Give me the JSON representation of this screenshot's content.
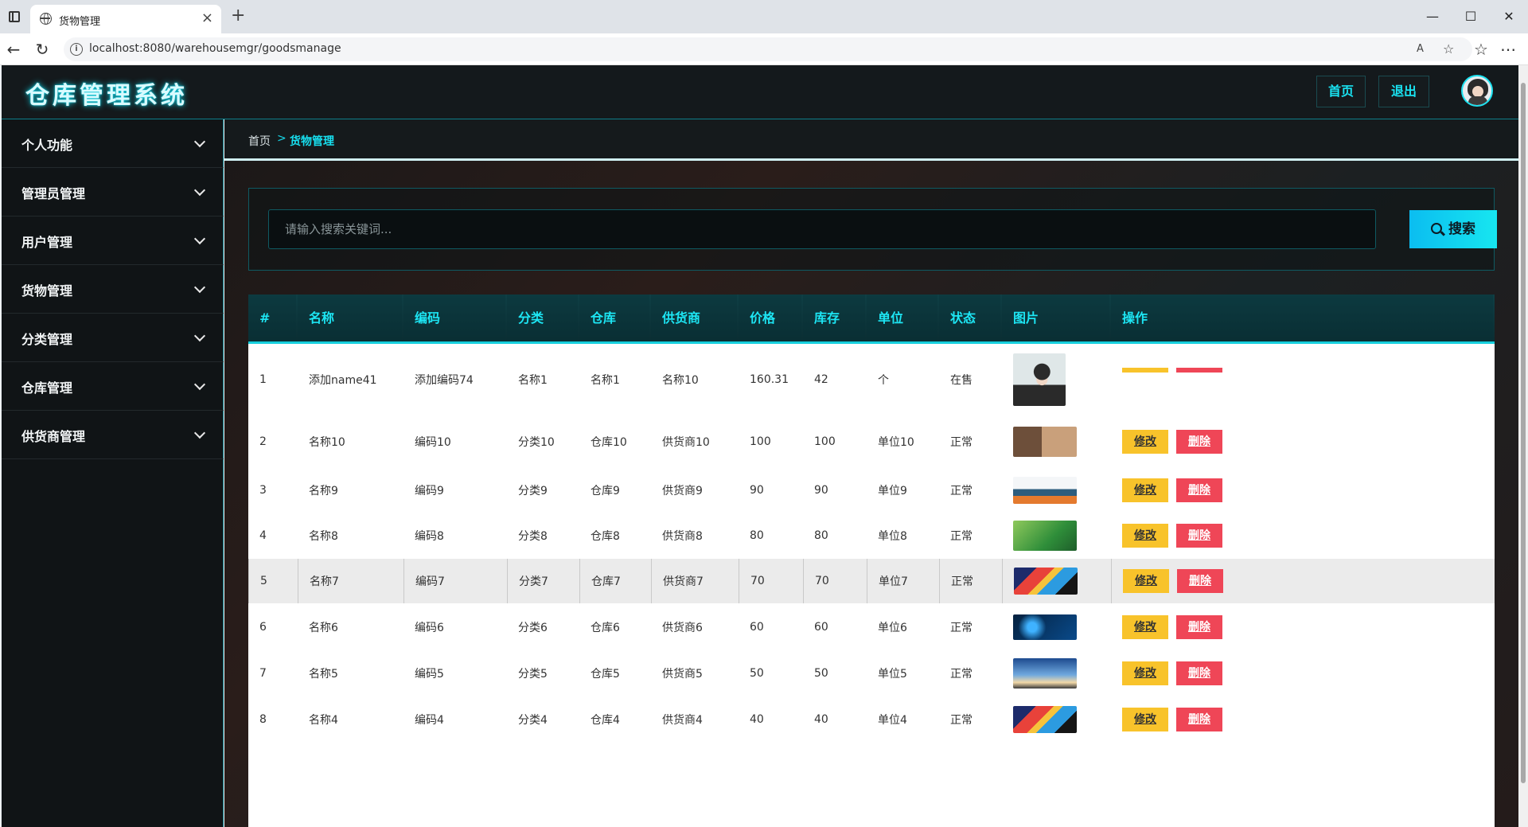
{
  "browser": {
    "tab_title": "货物管理",
    "url": "localhost:8080/warehousemgr/goodsmanage"
  },
  "header": {
    "app_title": "仓库管理系统",
    "home_label": "首页",
    "logout_label": "退出"
  },
  "sidebar": {
    "items": [
      {
        "label": "个人功能"
      },
      {
        "label": "管理员管理"
      },
      {
        "label": "用户管理"
      },
      {
        "label": "货物管理"
      },
      {
        "label": "分类管理"
      },
      {
        "label": "仓库管理"
      },
      {
        "label": "供货商管理"
      }
    ]
  },
  "breadcrumb": {
    "home": "首页",
    "separator": ">",
    "current": "货物管理"
  },
  "search": {
    "placeholder": "请输入搜索关键词...",
    "button_label": "搜索"
  },
  "table": {
    "columns": [
      "#",
      "名称",
      "编码",
      "分类",
      "仓库",
      "供货商",
      "价格",
      "库存",
      "单位",
      "状态",
      "图片",
      "操作"
    ],
    "edit_label": "修改",
    "delete_label": "删除",
    "rows": [
      {
        "id": "1",
        "name": "添加name41",
        "code": "添加编码74",
        "category": "名称1",
        "warehouse": "名称1",
        "supplier": "名称10",
        "price": "160.31",
        "stock": "42",
        "unit": "个",
        "status": "在售",
        "image": "portrait-illustration"
      },
      {
        "id": "2",
        "name": "名称10",
        "code": "编码10",
        "category": "分类10",
        "warehouse": "仓库10",
        "supplier": "供货商10",
        "price": "100",
        "stock": "100",
        "unit": "单位10",
        "status": "正常",
        "image": "interior-banner"
      },
      {
        "id": "3",
        "name": "名称9",
        "code": "编码9",
        "category": "分类9",
        "warehouse": "仓库9",
        "supplier": "供货商9",
        "price": "90",
        "stock": "90",
        "unit": "单位9",
        "status": "正常",
        "image": "mountain-sunset"
      },
      {
        "id": "4",
        "name": "名称8",
        "code": "编码8",
        "category": "分类8",
        "warehouse": "仓库8",
        "supplier": "供货商8",
        "price": "80",
        "stock": "80",
        "unit": "单位8",
        "status": "正常",
        "image": "green-essence-ad"
      },
      {
        "id": "5",
        "name": "名称7",
        "code": "编码7",
        "category": "分类7",
        "warehouse": "仓库7",
        "supplier": "供货商7",
        "price": "70",
        "stock": "70",
        "unit": "单位7",
        "status": "正常",
        "image": "colorful-abstract"
      },
      {
        "id": "6",
        "name": "名称6",
        "code": "编码6",
        "category": "分类6",
        "warehouse": "仓库6",
        "supplier": "供货商6",
        "price": "60",
        "stock": "60",
        "unit": "单位6",
        "status": "正常",
        "image": "blue-tech"
      },
      {
        "id": "7",
        "name": "名称5",
        "code": "编码5",
        "category": "分类5",
        "warehouse": "仓库5",
        "supplier": "供货商5",
        "price": "50",
        "stock": "50",
        "unit": "单位5",
        "status": "正常",
        "image": "sky-horizon"
      },
      {
        "id": "8",
        "name": "名称4",
        "code": "编码4",
        "category": "分类4",
        "warehouse": "仓库4",
        "supplier": "供货商4",
        "price": "40",
        "stock": "40",
        "unit": "单位4",
        "status": "正常",
        "image": "colorful-abstract"
      }
    ]
  },
  "colors": {
    "accent": "#17e0f0",
    "edit_button": "#f8c32b",
    "delete_button": "#ef4657",
    "header_bg": "#14191c"
  }
}
